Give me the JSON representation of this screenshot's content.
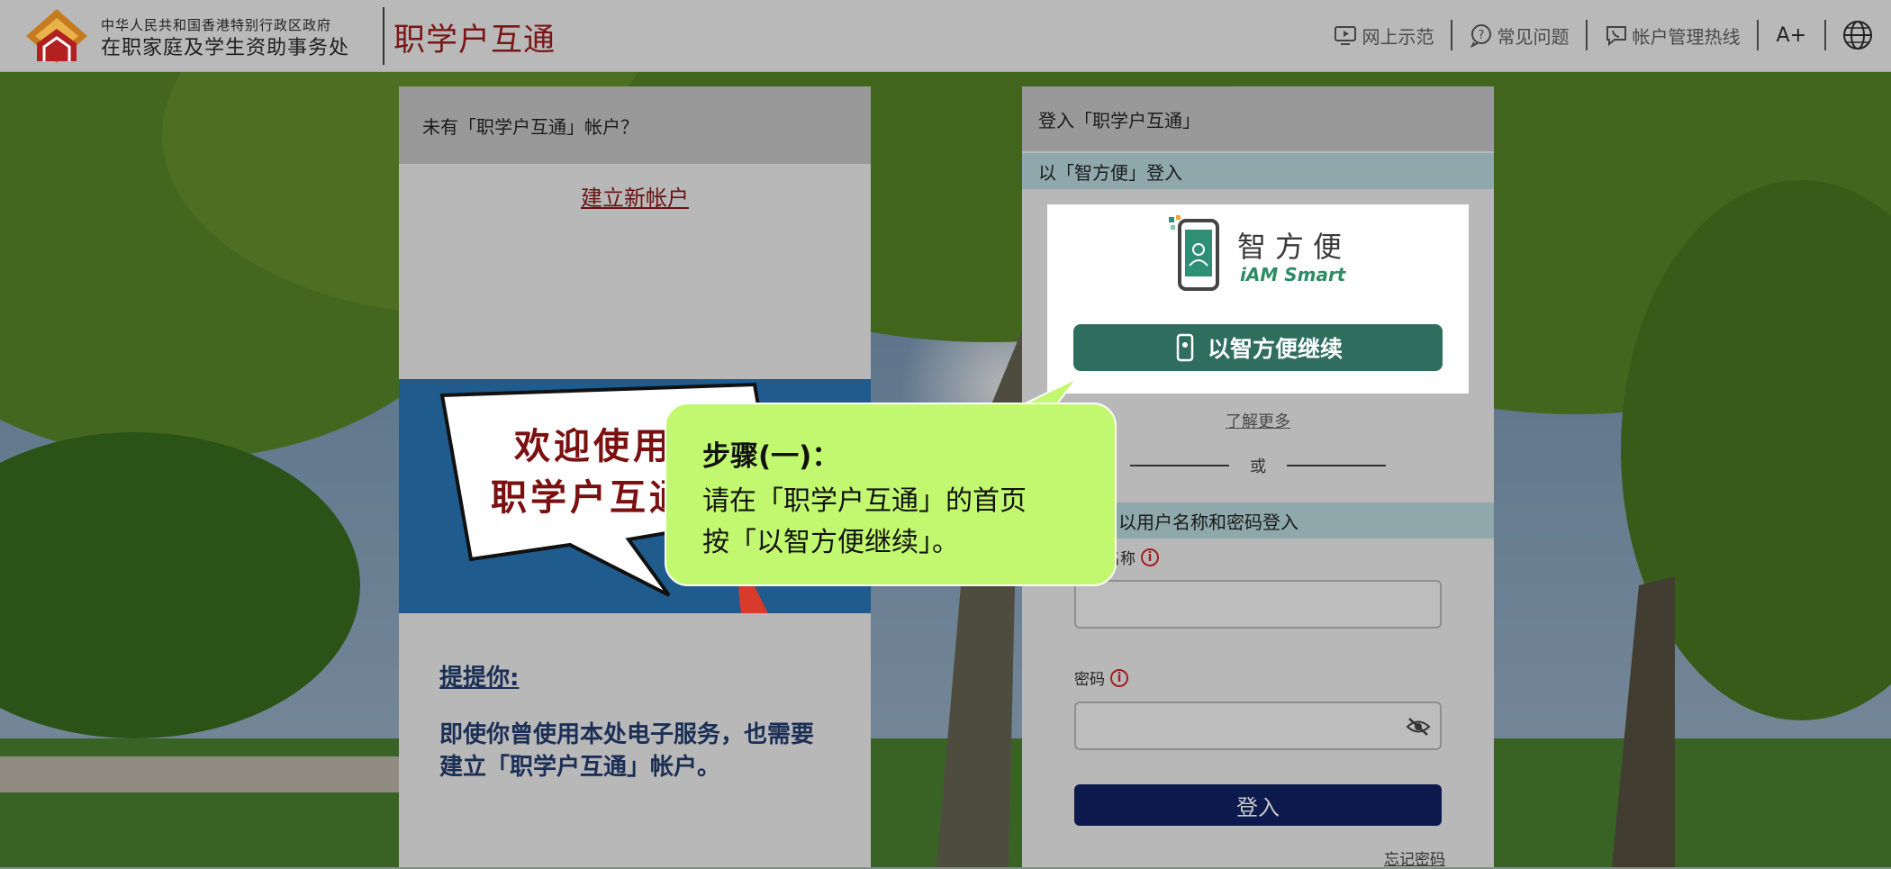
{
  "header": {
    "dept_line1": "中华人民共和国香港特别行政区政府",
    "dept_line2": "在职家庭及学生资助事务处",
    "app_title": "职学户互通",
    "nav": {
      "demo": "网上示范",
      "faq": "常见问题",
      "hotline": "帐户管理热线",
      "font_size": "A+"
    },
    "icons": {
      "demo": "video-demo-icon",
      "faq": "question-bubble-icon",
      "hotline": "phone-bubble-icon",
      "language": "globe-icon"
    }
  },
  "left_panel": {
    "heading": "未有「职学户互通」帐户？",
    "create_account": "建立新帐户",
    "banner_line1": "欢迎使用",
    "banner_line2": "职学户互通",
    "reminder_title": "提提你:",
    "reminder_text": "即使你曾使用本处电子服务，也需要建立「职学户互通」帐户。"
  },
  "right_panel": {
    "heading": "登入「职学户互通」",
    "iam_section": "以「智方便」登入",
    "iam_logo_cn": "智方便",
    "iam_logo_en": "iAM Smart",
    "iam_button": "以智方便继续",
    "learn_more": "了解更多",
    "or": "或",
    "pw_section": "以用户名称和密码登入",
    "username_label": "用户名称",
    "username_value": "",
    "password_label": "密码",
    "password_value": "",
    "info": "i",
    "login_button": "登入",
    "forgot_password": "忘记密码"
  },
  "callout": {
    "title": "步骤(一)：",
    "line1": "请在「职学户互通」的首页",
    "line2": "按「以智方便继续」。"
  },
  "colors": {
    "header_bg": "#b9b9b9",
    "brand_red": "#7a1616",
    "iam_green": "#2f6e5e",
    "login_navy": "#0d1a4d",
    "callout_green": "#c1f86f",
    "section_teal": "#8fa8ab"
  }
}
